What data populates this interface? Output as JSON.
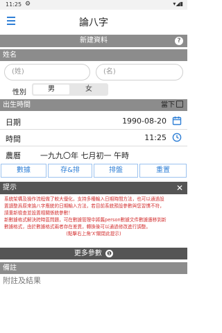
{
  "status": {
    "time": "11:25",
    "gear": "⚙",
    "icons": "▾◢▮"
  },
  "app": {
    "title": "論八字"
  },
  "new_data": {
    "label": "新建資料",
    "help": "?"
  },
  "name_section": {
    "label": "姓名"
  },
  "surname": {
    "placeholder": "(姓)"
  },
  "given_name": {
    "placeholder": "(名)"
  },
  "gender": {
    "label": "性別",
    "male": "男",
    "female": "女",
    "selected": "男"
  },
  "birth_section": {
    "label": "出生時間",
    "now": "當下"
  },
  "date": {
    "label": "日期",
    "value": "1990-08-20"
  },
  "time": {
    "label": "時間",
    "value": "11:25"
  },
  "lunar": {
    "label": "農曆",
    "value": "一九九〇年 七月初一 午時"
  },
  "buttons": {
    "data": "數據",
    "save": "存&排",
    "chart": "排盤",
    "reset": "重置"
  },
  "tips": {
    "label": "提示",
    "close": "✕",
    "line1": "系統架構及操作流程做了較大優化，支持多種輸入日期時間方法，也可以通過設",
    "line2": "置讀整爲原來論八字應統的日期輸入方法，若目前系統預設參數與您習慣不符，",
    "line3": "請重新檢查並設置相關係統參數！",
    "line4": "新數據格式解決跨時區問題，可在數據管理中將舊person數據文件數據遷移到新",
    "line5": "數據格式，由於數據格式兩者存在差異，轉換後可以通過修改進行調整。",
    "line6": "(點擊右上角'X'關閉此提示)"
  },
  "more": {
    "label": "更多參數",
    "badge": "❶"
  },
  "notes": {
    "label": "備註",
    "placeholder": "附註及結果"
  },
  "colors": {
    "accent": "#2f7fd6",
    "header_bar": "#8c8c8c",
    "tip_text": "#d32f2f"
  }
}
